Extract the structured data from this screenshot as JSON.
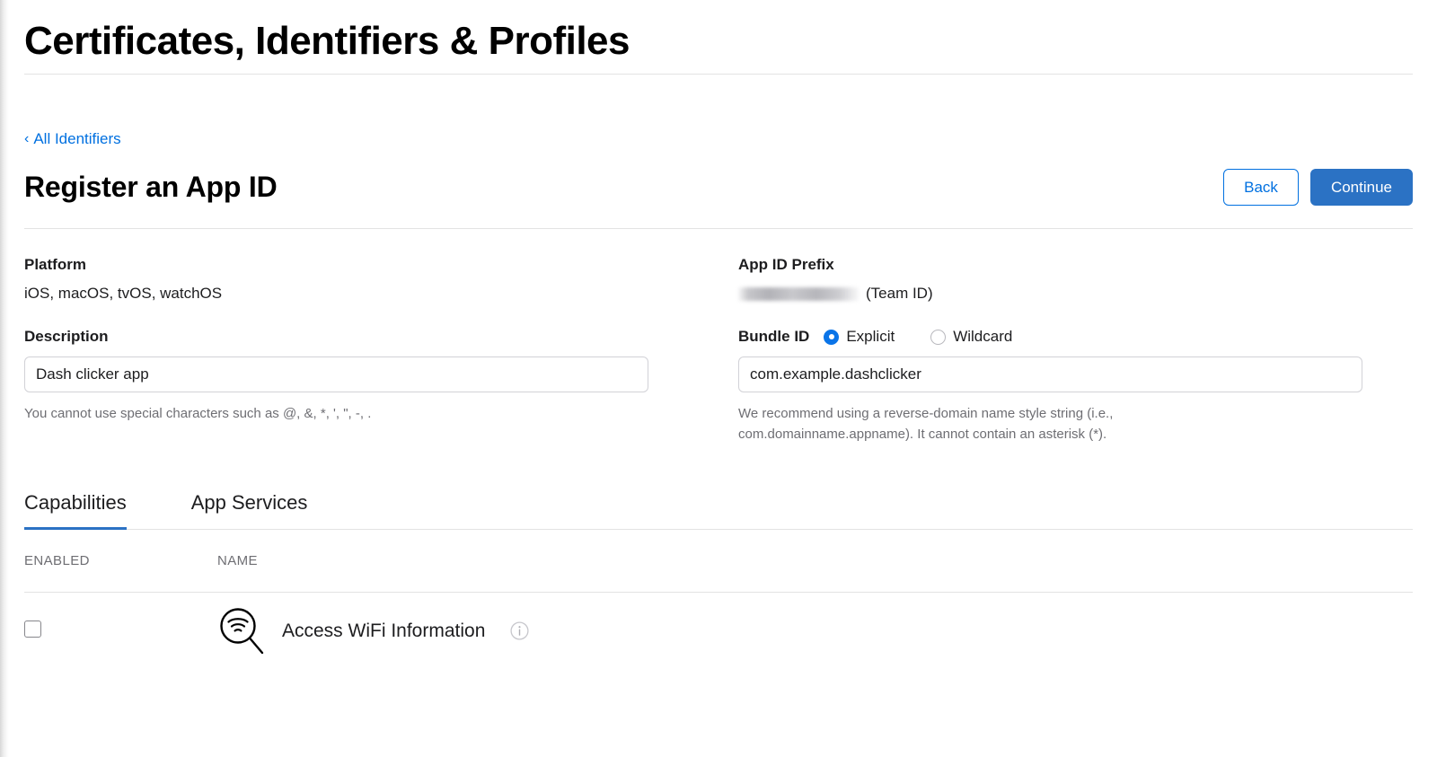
{
  "header": {
    "title": "Certificates, Identifiers & Profiles"
  },
  "breadcrumb": {
    "chevron": "‹",
    "label": "All Identifiers"
  },
  "page": {
    "title": "Register an App ID"
  },
  "actions": {
    "back_label": "Back",
    "continue_label": "Continue"
  },
  "form": {
    "platform": {
      "label": "Platform",
      "value": "iOS, macOS, tvOS, watchOS"
    },
    "description": {
      "label": "Description",
      "value": "Dash clicker app",
      "placeholder": "",
      "help": "You cannot use special characters such as @, &, *, ', \", -, ."
    },
    "app_id_prefix": {
      "label": "App ID Prefix",
      "redacted_value": "",
      "suffix": "(Team ID)"
    },
    "bundle_id": {
      "label": "Bundle ID",
      "options": [
        {
          "label": "Explicit",
          "selected": true
        },
        {
          "label": "Wildcard",
          "selected": false
        }
      ],
      "value": "com.example.dashclicker",
      "placeholder": "",
      "help": "We recommend using a reverse-domain name style string (i.e., com.domainname.appname). It cannot contain an asterisk (*)."
    }
  },
  "tabs": [
    {
      "label": "Capabilities",
      "active": true
    },
    {
      "label": "App Services",
      "active": false
    }
  ],
  "table": {
    "columns": {
      "enabled": "ENABLED",
      "name": "NAME"
    },
    "rows": [
      {
        "enabled": false,
        "icon": "wifi-magnifier-icon",
        "name": "Access WiFi Information",
        "info": "i"
      }
    ]
  },
  "colors": {
    "link": "#0070e0",
    "primary_button": "#2b72c4",
    "tab_underline": "#2b72c4",
    "radio_selected": "#0a74e8",
    "divider": "#e3e3e3",
    "muted_text": "#6e6e73"
  }
}
